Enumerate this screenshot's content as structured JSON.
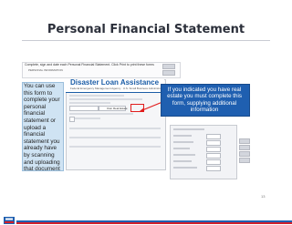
{
  "page": {
    "title": "Personal Financial Statement",
    "page_number": "13"
  },
  "instruction_strip": {
    "text": "Complete, sign and date each Personal Financial Statement. Click Print to print these forms",
    "subtext": "PERSONAL INFORMATION"
  },
  "left_callout": {
    "text": "You can use this form to complete your personal financial statement or upload a financial statement you already have by scanning and uploading that document"
  },
  "screenshot_panel": {
    "title": "Disaster Loan Assistance",
    "subtitle": "Federal Emergency Management Agency · U.S. Small Business Administration",
    "highlight_label": "Own Real Estate"
  },
  "right_callout": {
    "text": "If you indicated you have real estate you must complete this form, supplying additional information"
  },
  "colors": {
    "accent_blue": "#1f5fb0",
    "callout_light": "#cfe3f3",
    "highlight_red": "#e11d1d",
    "brand_red": "#d11f2b"
  },
  "icons": {
    "footer_logo": "sba-logo-icon"
  }
}
